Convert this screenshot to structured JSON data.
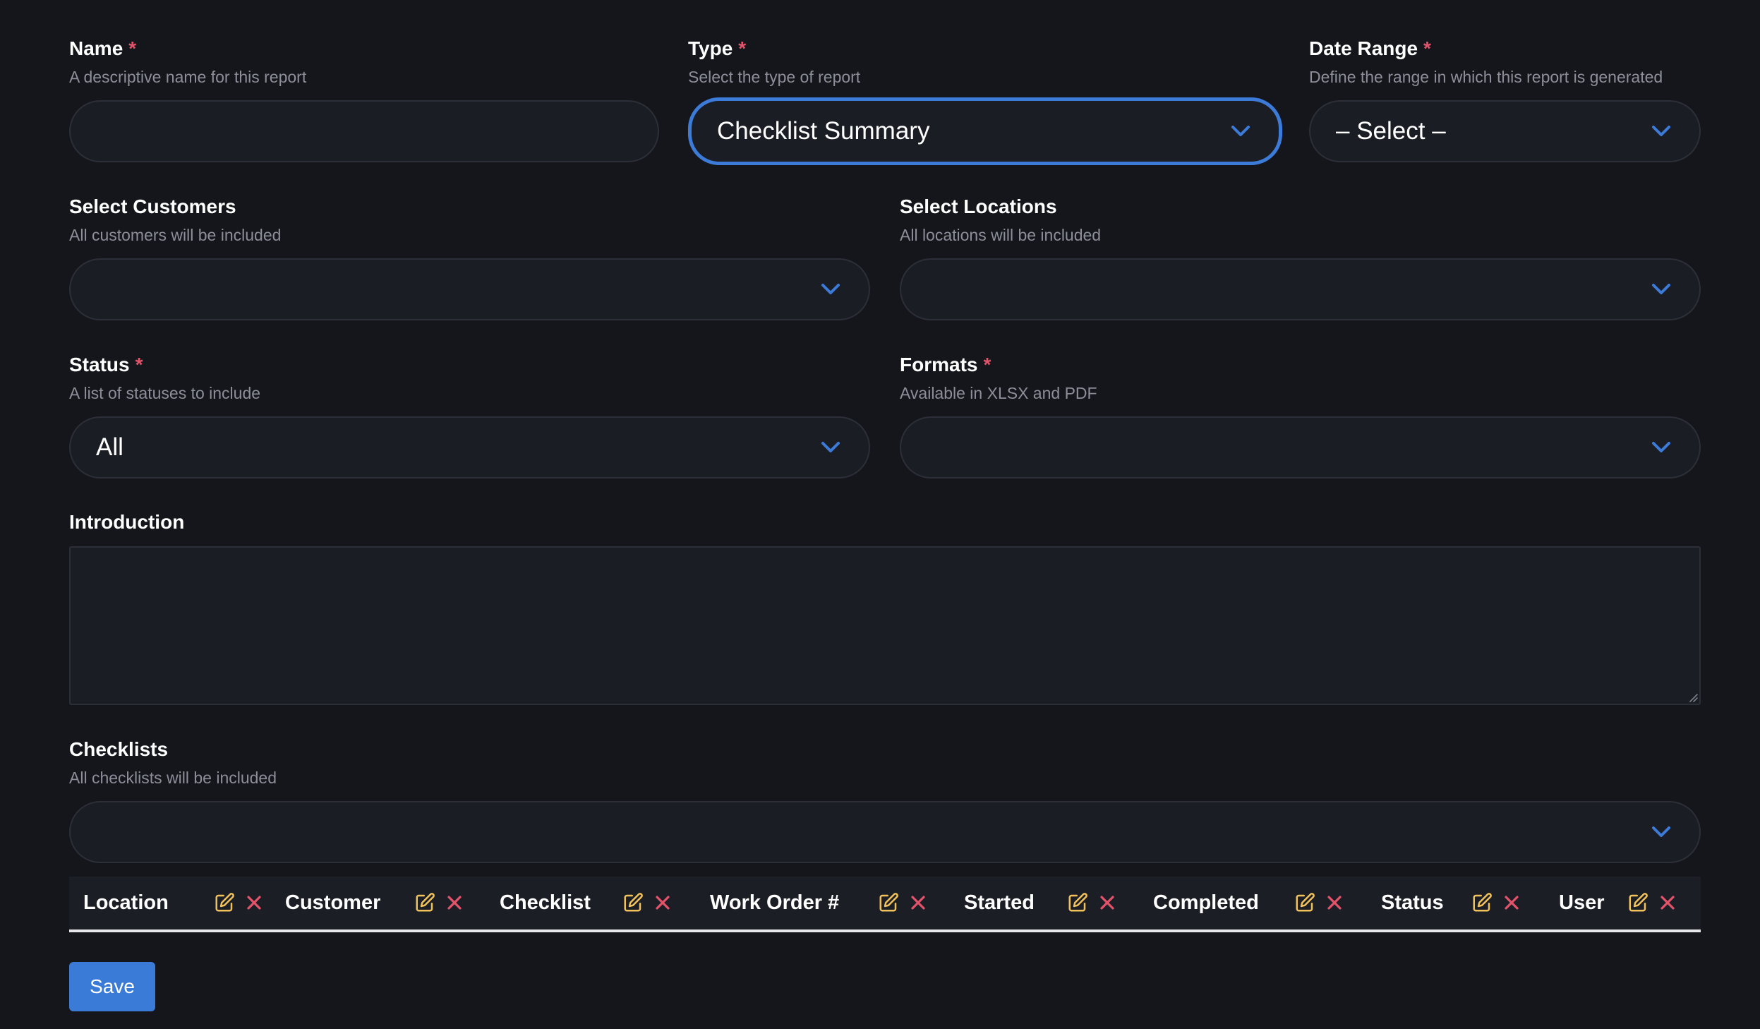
{
  "fields": {
    "name": {
      "label": "Name",
      "required_mark": "*",
      "help": "A descriptive name for this report",
      "value": ""
    },
    "type": {
      "label": "Type",
      "required_mark": "*",
      "help": "Select the type of report",
      "value": "Checklist Summary"
    },
    "date_range": {
      "label": "Date Range",
      "required_mark": "*",
      "help": "Define the range in which this report is generated",
      "value": "– Select –"
    },
    "customers": {
      "label": "Select Customers",
      "help": "All customers will be included",
      "value": ""
    },
    "locations": {
      "label": "Select Locations",
      "help": "All locations will be included",
      "value": ""
    },
    "status": {
      "label": "Status",
      "required_mark": "*",
      "help": "A list of statuses to include",
      "value": "All"
    },
    "formats": {
      "label": "Formats",
      "required_mark": "*",
      "help": "Available in XLSX and PDF",
      "value": ""
    },
    "introduction": {
      "label": "Introduction",
      "value": ""
    },
    "checklists": {
      "label": "Checklists",
      "help": "All checklists will be included",
      "value": ""
    }
  },
  "columns": [
    {
      "label": "Location",
      "edit_icon": "edit-icon",
      "remove_icon": "close-icon"
    },
    {
      "label": "Customer",
      "edit_icon": "edit-icon",
      "remove_icon": "close-icon"
    },
    {
      "label": "Checklist",
      "edit_icon": "edit-icon",
      "remove_icon": "close-icon"
    },
    {
      "label": "Work Order #",
      "edit_icon": "edit-icon",
      "remove_icon": "close-icon"
    },
    {
      "label": "Started",
      "edit_icon": "edit-icon",
      "remove_icon": "close-icon"
    },
    {
      "label": "Completed",
      "edit_icon": "edit-icon",
      "remove_icon": "close-icon"
    },
    {
      "label": "Status",
      "edit_icon": "edit-icon",
      "remove_icon": "close-icon"
    },
    {
      "label": "User",
      "edit_icon": "edit-icon",
      "remove_icon": "close-icon"
    }
  ],
  "save_label": "Save",
  "colors": {
    "background": "#15161c",
    "input_background": "#1b1d25",
    "accent": "#3d7bd9",
    "required": "#e3536a",
    "edit_icon": "#f2c25a",
    "remove_icon": "#e3536a"
  }
}
